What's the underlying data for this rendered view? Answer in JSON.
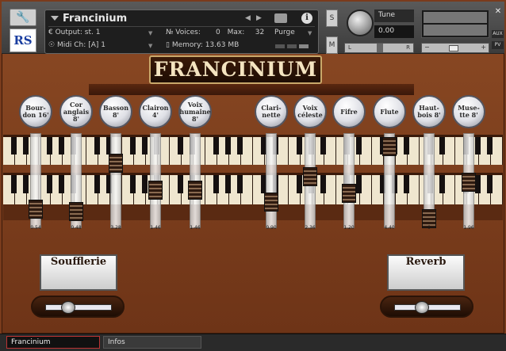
{
  "header": {
    "instrument_name": "Francinium",
    "output_label": "Output:",
    "output_value": "st. 1",
    "voices_label": "Voices:",
    "voices_value": "0",
    "max_label": "Max:",
    "max_value": "32",
    "purge_label": "Purge",
    "midi_label": "Midi Ch:",
    "midi_value": "[A]  1",
    "memory_label": "Memory:",
    "memory_value": "13.63 MB",
    "solo_label": "S",
    "mute_label": "M",
    "tune_label": "Tune",
    "tune_value": "0.00",
    "pan_left": "L",
    "pan_right": "R",
    "aux_label": "AUX",
    "pv_label": "PV",
    "logo_text": "RS"
  },
  "brand": {
    "title": "FRANCINIUM"
  },
  "stops": [
    {
      "label": "Bour-\ndon 16'",
      "value": "0.54",
      "level": 0.16
    },
    {
      "label": "Cor\nanglais\n8'",
      "value": "0.48",
      "level": 0.13
    },
    {
      "label": "Basson\n8'",
      "value": "3.28",
      "level": 0.74
    },
    {
      "label": "Clairon\n4'",
      "value": "1.46",
      "level": 0.4
    },
    {
      "label": "Voix\nhumaine 8'",
      "value": "1.46",
      "level": 0.4
    },
    {
      "label": "Clari-\nnette",
      "value": "0.90",
      "level": 0.25
    },
    {
      "label": "Voix\ncéleste",
      "value": "2.36",
      "level": 0.57
    },
    {
      "label": "Fifre",
      "value": "1.20",
      "level": 0.36
    },
    {
      "label": "Flute",
      "value": "4.40",
      "level": 0.95
    },
    {
      "label": "Haut-\nbois 8'",
      "value": "0",
      "level": 0.04
    },
    {
      "label": "Muse-\ntte 8'",
      "value": "1.96",
      "level": 0.5
    }
  ],
  "effects": {
    "soufflerie_label": "Soufflerie",
    "reverb_label": "Reverb",
    "soufflerie_level": 0.3,
    "reverb_level": 0.4
  },
  "footer": {
    "tab_instrument": "Francinium",
    "tab_infos": "Infos"
  }
}
